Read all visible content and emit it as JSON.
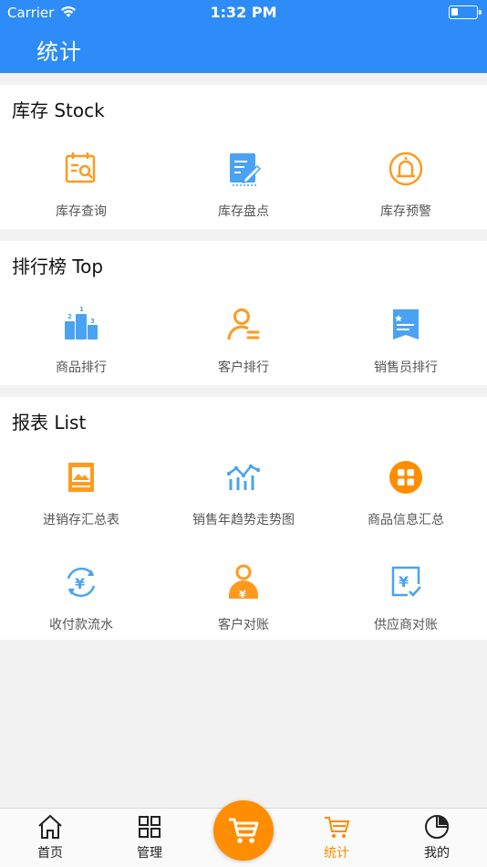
{
  "status": {
    "carrier": "Carrier",
    "time": "1:32 PM"
  },
  "header": {
    "title": "统计"
  },
  "sections": [
    {
      "title": "库存 Stock",
      "items": [
        {
          "label": "库存查询",
          "icon": "inventory-search-icon"
        },
        {
          "label": "库存盘点",
          "icon": "inventory-count-icon"
        },
        {
          "label": "库存预警",
          "icon": "inventory-alarm-icon"
        }
      ]
    },
    {
      "title": "排行榜 Top",
      "items": [
        {
          "label": "商品排行",
          "icon": "podium-icon"
        },
        {
          "label": "客户排行",
          "icon": "customer-ranking-icon"
        },
        {
          "label": "销售员排行",
          "icon": "badge-list-icon"
        }
      ]
    },
    {
      "title": "报表 List",
      "items": [
        {
          "label": "进销存汇总表",
          "icon": "picture-report-icon"
        },
        {
          "label": "销售年趋势走势图",
          "icon": "trend-chart-icon"
        },
        {
          "label": "商品信息汇总",
          "icon": "grid-circle-icon"
        },
        {
          "label": "收付款流水",
          "icon": "yuan-cycle-icon"
        },
        {
          "label": "客户对账",
          "icon": "customer-yuan-icon"
        },
        {
          "label": "供应商对账",
          "icon": "yuan-check-icon"
        }
      ]
    }
  ],
  "tabs": [
    {
      "label": "首页",
      "icon": "home-icon"
    },
    {
      "label": "管理",
      "icon": "grid-icon"
    },
    {
      "label": "统计",
      "icon": "cart-icon",
      "active": true
    },
    {
      "label": "我的",
      "icon": "pie-icon"
    }
  ],
  "fab": {
    "icon": "cart-icon"
  },
  "colors": {
    "primary": "#2d8cf7",
    "accent": "#ff8d00",
    "blue_icon": "#4aa3f2"
  }
}
